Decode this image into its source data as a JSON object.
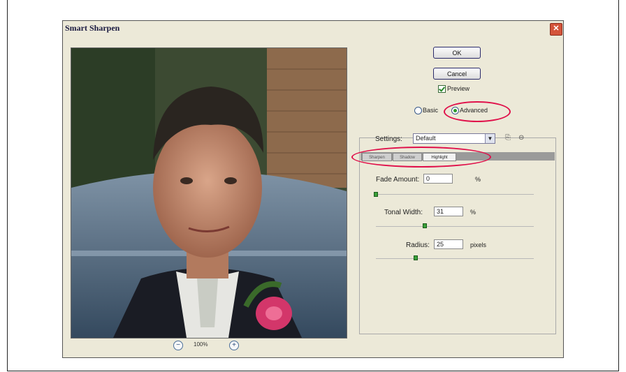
{
  "window": {
    "title": "Smart Sharpen"
  },
  "buttons": {
    "ok": "OK",
    "cancel": "Cancel",
    "close": "✕"
  },
  "preview_check": {
    "label": "Preview",
    "checked": true
  },
  "mode": {
    "basic": "Basic",
    "advanced": "Advanced",
    "selected": "Advanced"
  },
  "settings": {
    "label": "Settings:",
    "value": "Default"
  },
  "tabs": [
    "Sharpen",
    "Shadow",
    "Highlight"
  ],
  "active_tab": "Highlight",
  "fields": {
    "fade": {
      "label": "Fade Amount:",
      "value": "0",
      "unit": "%",
      "slider_fraction": 0.0
    },
    "tonal": {
      "label": "Tonal Width:",
      "value": "31",
      "unit": "%",
      "slider_fraction": 0.31
    },
    "radius": {
      "label": "Radius:",
      "value": "25",
      "unit": "pixels",
      "slider_fraction": 0.25
    }
  },
  "zoom": {
    "level": "100%"
  },
  "colors": {
    "highlight_ring": "#e0104a",
    "dialog_bg": "#ece9d8"
  },
  "icons": {
    "save_settings": "save-preset-icon",
    "delete_settings": "delete-preset-icon"
  }
}
